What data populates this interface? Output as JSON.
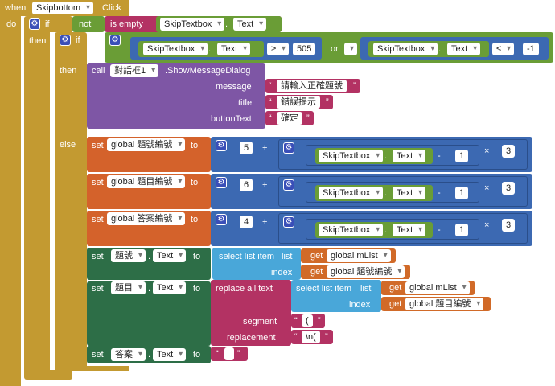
{
  "event": {
    "when": "when",
    "component": "Skipbottom",
    "action": ".Click",
    "do": "do"
  },
  "kw": {
    "if": "if",
    "then": "then",
    "else": "else",
    "not": "not",
    "is_empty": "is empty",
    "or": "or",
    "set": "set",
    "to": "to",
    "get": "get",
    "call": "call",
    "select_list_item": "select list item",
    "list": "list",
    "index": "index",
    "replace_all_text": "replace all text",
    "segment": "segment",
    "replacement": "replacement"
  },
  "ops": {
    "gte": "≥",
    "lte": "≤",
    "plus": "+",
    "minus": "-",
    "times": "×"
  },
  "components": {
    "skiptextbox": "SkipTextbox",
    "text_prop": "Text",
    "dialog": "對話框1",
    "show_message": ".ShowMessageDialog",
    "lbl_num": "題號",
    "lbl_q": "題目",
    "lbl_ans": "答案"
  },
  "dialog": {
    "message_label": "message",
    "message": "請輸入正確題號",
    "title_label": "title",
    "title": "錯誤提示",
    "button_label": "buttonText",
    "button": "確定"
  },
  "numbers": {
    "n505": "505",
    "nneg1": "-1",
    "n5": "5",
    "n6": "6",
    "n4": "4",
    "n1": "1",
    "n3": "3"
  },
  "globals": {
    "q_num_idx": "global 題號編號",
    "q_idx": "global 題目編號",
    "a_idx": "global 答案編號",
    "mlist": "global mList"
  },
  "strings": {
    "segment": "(",
    "replacement": "\\n(",
    "empty": ""
  }
}
